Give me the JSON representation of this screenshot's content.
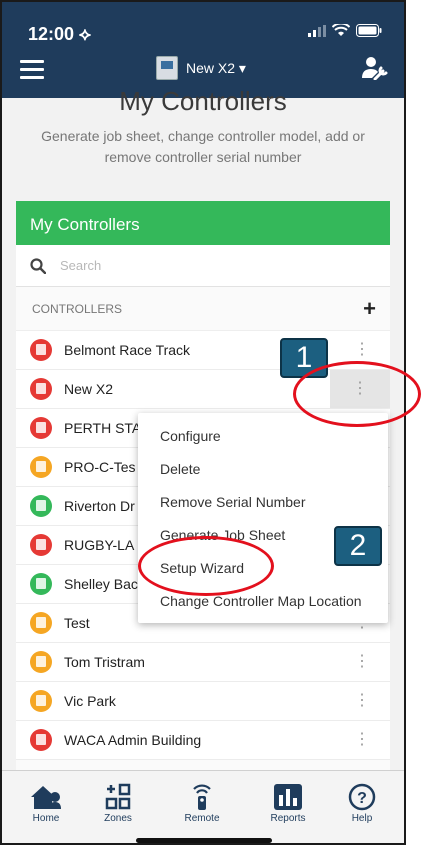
{
  "status": {
    "time": "12:00 ⟡"
  },
  "header": {
    "controller": "New X2 ▾"
  },
  "page": {
    "title": "My Controllers",
    "subtitle": "Generate job sheet, change controller model, add or remove controller serial number"
  },
  "card": {
    "title": "My Controllers"
  },
  "search": {
    "placeholder": "Search"
  },
  "section": {
    "label": "CONTROLLERS",
    "add": "+"
  },
  "controllers": [
    {
      "name": "Belmont Race Track",
      "color": "#e53935"
    },
    {
      "name": "New X2",
      "color": "#e53935"
    },
    {
      "name": "PERTH STA",
      "color": "#e53935"
    },
    {
      "name": "PRO-C-Tes",
      "color": "#f5a623"
    },
    {
      "name": "Riverton Dr",
      "color": "#34b85a"
    },
    {
      "name": "RUGBY-LA",
      "color": "#e53935"
    },
    {
      "name": "Shelley Bac",
      "color": "#34b85a"
    },
    {
      "name": "Test",
      "color": "#f5a623"
    },
    {
      "name": "Tom Tristram",
      "color": "#f5a623"
    },
    {
      "name": "Vic Park",
      "color": "#f5a623"
    },
    {
      "name": "WACA Admin Building",
      "color": "#e53935"
    }
  ],
  "menu": [
    "Configure",
    "Delete",
    "Remove Serial Number",
    "Generate Job Sheet",
    "Setup Wizard",
    "Change Controller Map Location"
  ],
  "badges": {
    "step1": "1",
    "step2": "2"
  },
  "tabs": {
    "home": "Home",
    "zones": "Zones",
    "remote": "Remote",
    "reports": "Reports",
    "help": "Help"
  },
  "icons": {
    "menu": "hamburger-menu-icon",
    "tools": "user-wrench-icon",
    "search": "search-icon",
    "kebab": "kebab-menu-icon"
  },
  "colors": {
    "header": "#1f3c5c",
    "green": "#34b85a",
    "annotation": "#e3101d",
    "badge": "#1c5f80"
  }
}
